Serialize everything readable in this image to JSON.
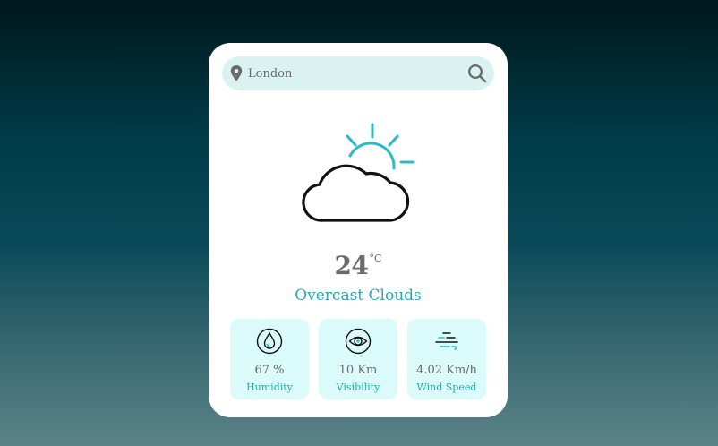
{
  "search": {
    "value": "",
    "placeholder": "London"
  },
  "weather": {
    "icon": "partly-cloudy-icon",
    "temperature": "24",
    "unit": "°C",
    "condition": "Overcast Clouds"
  },
  "stats": [
    {
      "icon": "humidity-icon",
      "value": "67 %",
      "label": "Humidity"
    },
    {
      "icon": "visibility-icon",
      "value": "10 Km",
      "label": "Visibility"
    },
    {
      "icon": "wind-icon",
      "value": "4.02 Km/h",
      "label": "Wind Speed"
    }
  ],
  "colors": {
    "accent": "#27a7b7",
    "search_bg": "#daf3f1",
    "stat_bg": "#dafbfa",
    "text": "#6b6b6b"
  }
}
